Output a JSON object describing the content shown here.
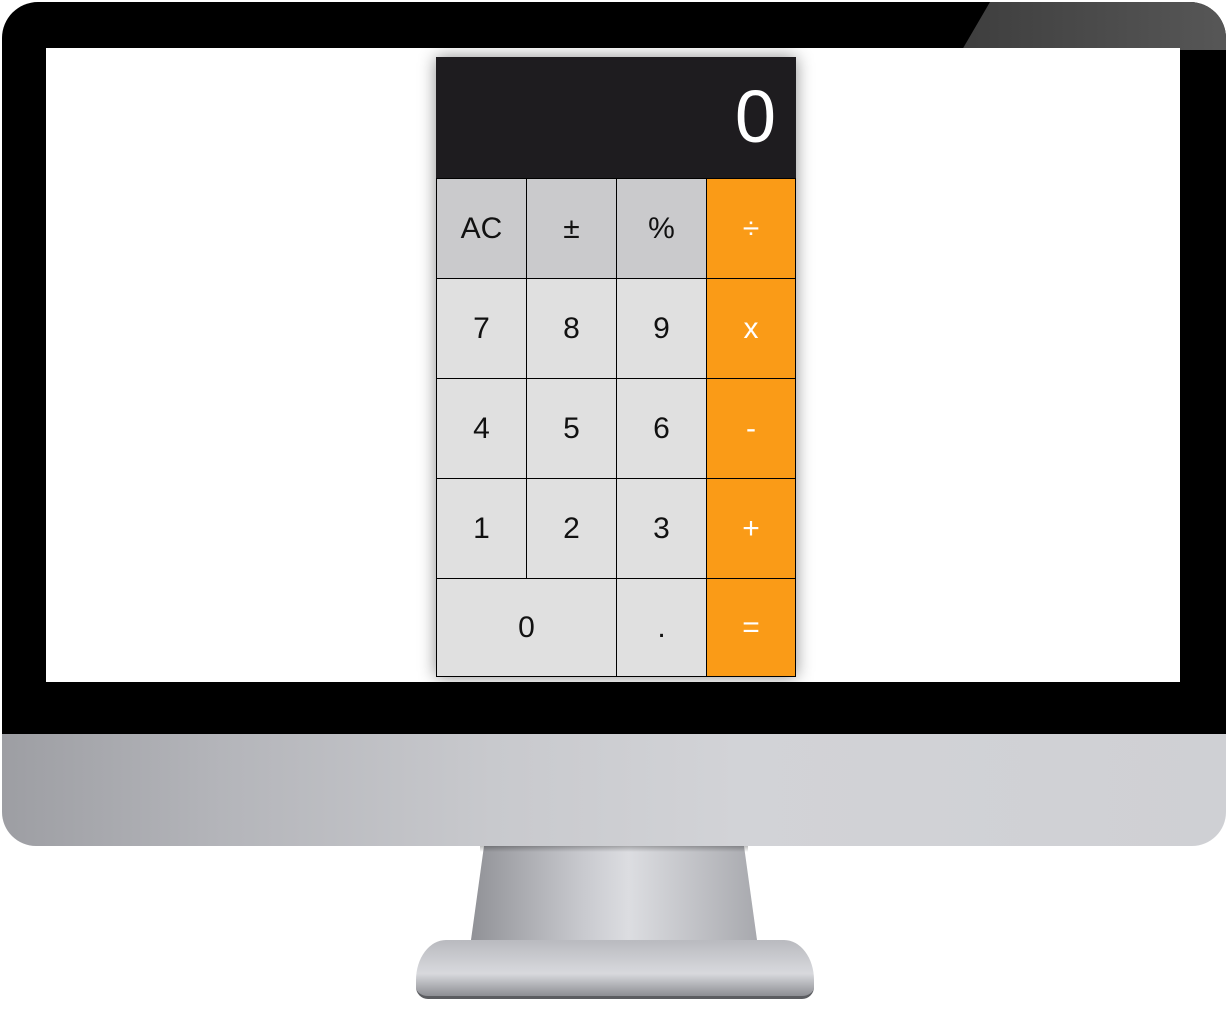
{
  "calculator": {
    "display": "0",
    "keys": {
      "ac": "AC",
      "sign": "±",
      "percent": "%",
      "divide": "÷",
      "seven": "7",
      "eight": "8",
      "nine": "9",
      "multiply": "x",
      "four": "4",
      "five": "5",
      "six": "6",
      "subtract": "-",
      "one": "1",
      "two": "2",
      "three": "3",
      "add": "+",
      "zero": "0",
      "decimal": ".",
      "equals": "="
    }
  },
  "colors": {
    "display_bg": "#1e1c1f",
    "function_key": "#cacacc",
    "number_key": "#e0e0e0",
    "operator_key": "#fa9b17"
  },
  "icons": [
    "monitor-frame"
  ]
}
